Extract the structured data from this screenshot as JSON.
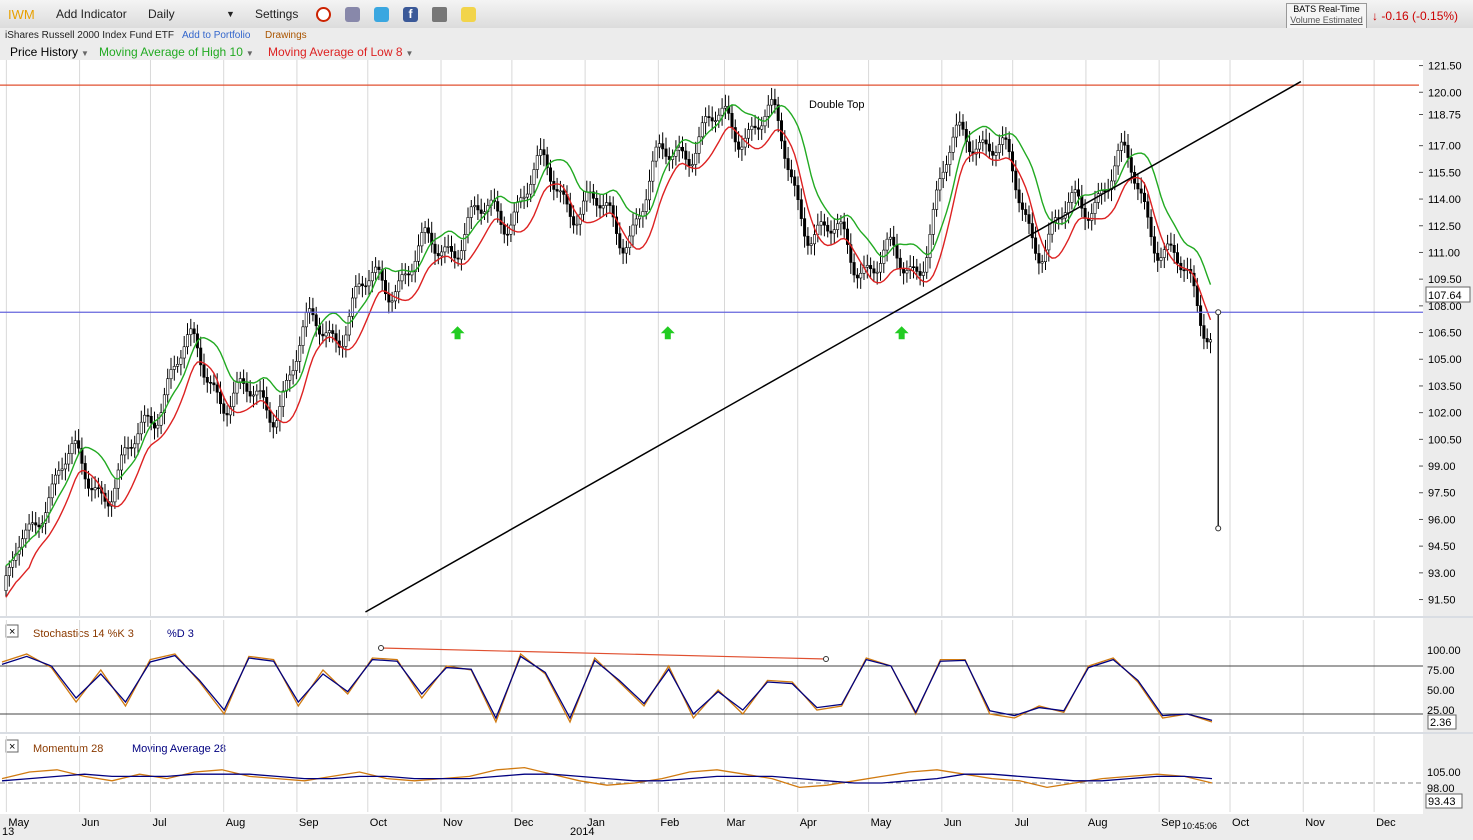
{
  "toolbar": {
    "symbol": "IWM",
    "add_indicator": "Add Indicator",
    "interval": "Daily",
    "settings": "Settings",
    "fund_name": "iShares Russell 2000 Index Fund ETF",
    "add_portfolio": "Add to Portfolio",
    "drawings": "Drawings",
    "feed_line1": "BATS Real-Time",
    "feed_line2": "Volume Estimated",
    "change": "-0.16 (-0.15%)",
    "icons": [
      "alarm-clock-icon",
      "books-icon",
      "twitter-icon",
      "facebook-icon",
      "camera-icon",
      "sticky-note-icon"
    ]
  },
  "legend": {
    "price": "Price History",
    "ma_high": "Moving Average of High 10",
    "ma_low": "Moving Average of Low 8",
    "stoch_label": "Stochastics 14 %K 3",
    "stoch_d": "%D 3",
    "mom_label": "Momentum 28",
    "mom_ma": "Moving Average 28"
  },
  "colors": {
    "ma_high": "#22aa22",
    "ma_low": "#dd2222",
    "resistance": "#e05030",
    "support": "#6666dd",
    "trendline": "#000000",
    "stoch_k": "#d07a10",
    "stoch_d": "#000080",
    "arrow": "#22cc22"
  },
  "chart_data": [
    {
      "type": "candlestick",
      "title": "IWM",
      "ylim": [
        90.8,
        121.7
      ],
      "y_ticks": [
        "121.50",
        "120.00",
        "118.75",
        "117.00",
        "115.50",
        "114.00",
        "112.50",
        "111.00",
        "109.50",
        "108.00",
        "106.50",
        "105.00",
        "103.50",
        "102.00",
        "100.50",
        "99.00",
        "97.50",
        "96.00",
        "94.50",
        "93.00",
        "91.50"
      ],
      "last_price": "107.64",
      "annotation": "Double Top",
      "x_labels": [
        "May",
        "Jun",
        "Jul",
        "Aug",
        "Sep",
        "Oct",
        "Nov",
        "Dec",
        "Jan",
        "Feb",
        "Mar",
        "Apr",
        "May",
        "Jun",
        "Jul",
        "Aug",
        "Sep",
        "Oct",
        "Nov",
        "Dec"
      ],
      "year_label": "2014",
      "start_year_fragment": "13",
      "time_label": "10:45:06",
      "monthly_close": {
        "months": [
          "2013-05",
          "2013-06",
          "2013-07",
          "2013-08",
          "2013-09",
          "2013-10",
          "2013-11",
          "2013-12",
          "2014-01",
          "2014-02",
          "2014-03",
          "2014-04",
          "2014-05",
          "2014-06",
          "2014-07",
          "2014-08",
          "2014-09"
        ],
        "close": [
          99.1,
          98.2,
          105.0,
          102.3,
          107.0,
          110.0,
          112.5,
          115.0,
          112.5,
          117.5,
          118.5,
          111.5,
          110.0,
          118.0,
          112.0,
          115.5,
          109.5
        ]
      },
      "levels": [
        {
          "name": "resistance",
          "value": 120.4
        },
        {
          "name": "support",
          "value": 107.64
        }
      ],
      "trendline": [
        {
          "date": "2013-09-30",
          "value": 90.8
        },
        {
          "date": "2014-10-31",
          "value": 120.6
        }
      ],
      "projection": [
        {
          "date": "2014-09-26",
          "value": 107.64
        },
        {
          "date": "2014-09-26",
          "value": 95.5
        }
      ],
      "support_arrows": [
        "2013-11-08",
        "2014-02-05",
        "2014-05-15"
      ]
    },
    {
      "type": "line",
      "title": "Stochastics 14 %K 3",
      "ylim": [
        0,
        110
      ],
      "y_ticks": [
        "100.00",
        "75.00",
        "50.00",
        "25.00"
      ],
      "levels": [
        80,
        20
      ],
      "last_value": "2.36",
      "series": [
        {
          "name": "%K",
          "values": [
            85,
            95,
            78,
            35,
            75,
            30,
            88,
            95,
            60,
            20,
            92,
            88,
            30,
            75,
            45,
            90,
            88,
            40,
            80,
            75,
            10,
            95,
            70,
            10,
            90,
            60,
            30,
            80,
            15,
            50,
            20,
            62,
            60,
            25,
            30,
            90,
            80,
            20,
            88,
            88,
            20,
            15,
            30,
            22,
            80,
            90,
            60,
            15,
            20,
            10
          ]
        },
        {
          "name": "%D",
          "values": [
            82,
            92,
            80,
            40,
            70,
            35,
            85,
            93,
            62,
            25,
            90,
            86,
            35,
            70,
            48,
            88,
            86,
            45,
            78,
            76,
            15,
            92,
            72,
            15,
            87,
            62,
            33,
            76,
            20,
            48,
            25,
            60,
            58,
            28,
            32,
            88,
            80,
            22,
            86,
            87,
            24,
            18,
            28,
            24,
            78,
            88,
            62,
            18,
            20,
            12
          ]
        }
      ]
    },
    {
      "type": "line",
      "title": "Momentum 28",
      "y_ticks": [
        "105.00",
        "98.00"
      ],
      "last_value": "93.43",
      "series": [
        {
          "name": "Momentum 28",
          "values": [
            100,
            103,
            104,
            101,
            99,
            102,
            100,
            103,
            104,
            101,
            100,
            99,
            101,
            103,
            100,
            99,
            100,
            101,
            104,
            105,
            102,
            99,
            97,
            98,
            100,
            103,
            104,
            102,
            100,
            96,
            97,
            99,
            101,
            103,
            104,
            102,
            100,
            99,
            96,
            98,
            100,
            101,
            102,
            101,
            98
          ]
        },
        {
          "name": "Moving Average 28",
          "values": [
            99,
            100,
            101,
            102,
            101,
            101,
            101,
            102,
            102,
            102,
            101,
            100,
            100,
            101,
            101,
            100,
            100,
            100,
            101,
            102,
            102,
            101,
            100,
            99,
            99,
            100,
            101,
            101,
            101,
            100,
            99,
            98,
            98,
            99,
            100,
            102,
            102,
            101,
            100,
            99,
            99,
            100,
            101,
            101,
            100
          ]
        }
      ]
    }
  ]
}
